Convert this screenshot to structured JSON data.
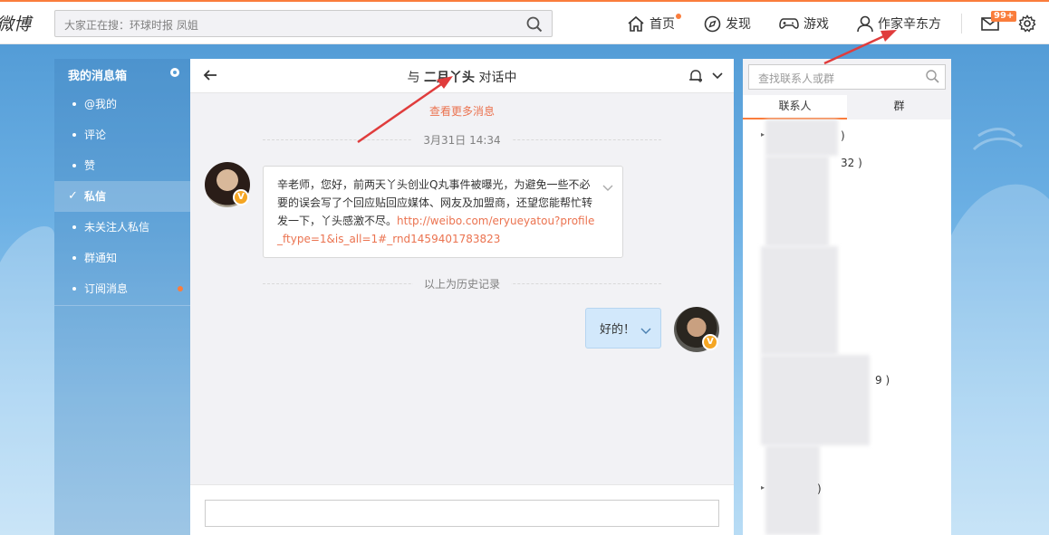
{
  "topbar": {
    "logo": "微博",
    "search_placeholder": "大家正在搜：环球时报 凤姐",
    "nav": [
      {
        "label": "首页"
      },
      {
        "label": "发现"
      },
      {
        "label": "游戏"
      },
      {
        "label": "作家辛东方"
      }
    ],
    "message_badge": "99+",
    "accent_color": "#fa7d3c"
  },
  "sidebar": {
    "title": "我的消息箱",
    "items": [
      {
        "label": "@我的"
      },
      {
        "label": "评论"
      },
      {
        "label": "赞"
      },
      {
        "label": "私信"
      },
      {
        "label": "未关注人私信"
      },
      {
        "label": "群通知"
      },
      {
        "label": "订阅消息"
      }
    ]
  },
  "chat": {
    "title_prefix": "与",
    "contact_name": "二月丫头",
    "title_suffix": "对话中",
    "load_more": "查看更多消息",
    "timestamp": "3月31日 14:34",
    "history_note": "以上为历史记录",
    "incoming_text": "辛老师，您好，前两天丫头创业Q丸事件被曝光，为避免一些不必要的误会写了个回应贴回应媒体、网友及加盟商，还望您能帮忙转发一下，丫头感激不尽。",
    "incoming_link": "http://weibo.com/eryueyatou?profile_ftype=1&is_all=1#_rnd1459401783823",
    "outgoing_text": "好的！",
    "verified_badge": "V"
  },
  "contacts": {
    "search_placeholder": "查找联系人或群",
    "tabs": [
      {
        "label": "联系人"
      },
      {
        "label": "群"
      }
    ],
    "visible_fragments": [
      ")",
      "32 )",
      "9 )",
      ")"
    ]
  }
}
